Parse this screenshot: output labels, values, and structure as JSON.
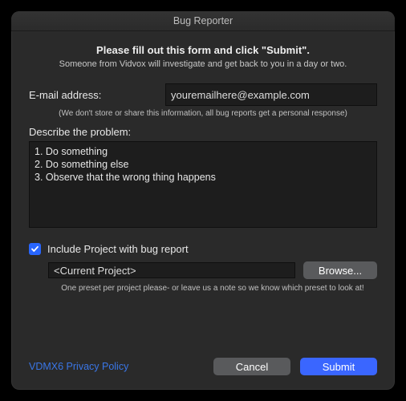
{
  "window": {
    "title": "Bug Reporter"
  },
  "header": {
    "heading": "Please fill out this form and click \"Submit\".",
    "subheading": "Someone from Vidvox will investigate and get back to you in a day or two."
  },
  "email": {
    "label": "E-mail address:",
    "value": "youremailhere@example.com",
    "fineprint": "(We don't store or share this information, all bug reports get a personal response)"
  },
  "describe": {
    "label": "Describe the problem:",
    "value": "1. Do something\n2. Do something else\n3. Observe that the wrong thing happens"
  },
  "include": {
    "checked": true,
    "label": "Include Project with bug report",
    "project_value": "<Current Project>",
    "browse_label": "Browse...",
    "preset_note": "One preset per project please- or leave us a note so we know which preset to look at!"
  },
  "footer": {
    "privacy_link": "VDMX6 Privacy Policy",
    "cancel_label": "Cancel",
    "submit_label": "Submit"
  }
}
